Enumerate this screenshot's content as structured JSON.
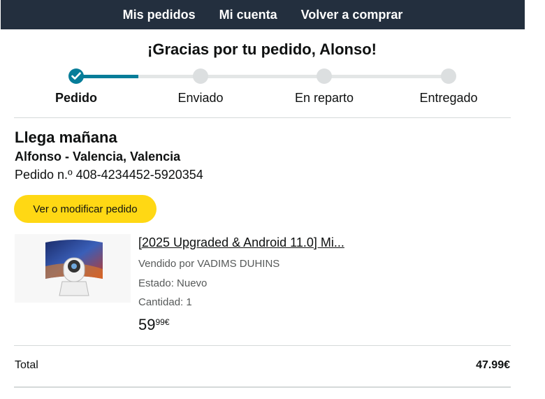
{
  "nav": {
    "items": [
      "Mis pedidos",
      "Mi cuenta",
      "Volver a comprar"
    ]
  },
  "header": {
    "title": "¡Gracias por tu pedido, Alonso!"
  },
  "progress": {
    "steps": [
      "Pedido",
      "Enviado",
      "En reparto",
      "Entregado"
    ],
    "completed_step": 1,
    "accent_color": "#067d99"
  },
  "delivery": {
    "eta": "Llega mañana",
    "address": "Alfonso - Valencia, Valencia",
    "order_number": "Pedido n.º 408-4234452-5920354",
    "view_button": "Ver o modificar pedido"
  },
  "item": {
    "title": "[2025 Upgraded & Android 11.0] Mi...",
    "seller": "Vendido por VADIMS DUHINS",
    "condition": "Estado: Nuevo",
    "quantity": "Cantidad: 1",
    "price_whole": "59",
    "price_fraction": "99€",
    "image": "projector-product-image"
  },
  "summary": {
    "total_label": "Total",
    "total_value": "47.99€"
  },
  "colors": {
    "nav_bg": "#232f3e",
    "button_bg": "#ffd814"
  }
}
